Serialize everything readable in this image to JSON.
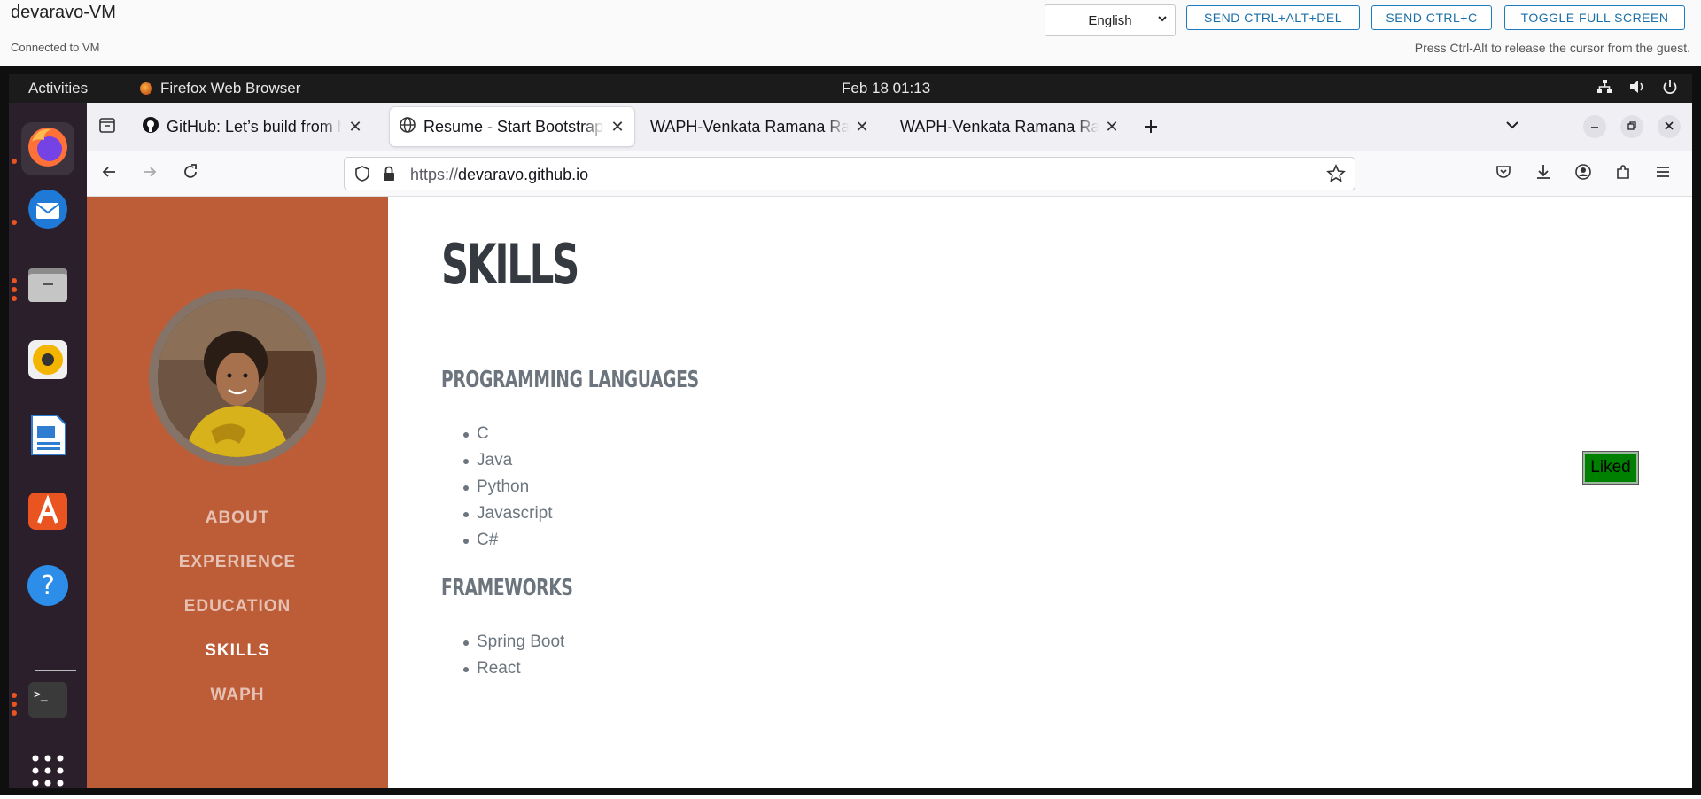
{
  "vm": {
    "title": "devaravo-VM",
    "status": "Connected to VM",
    "language": "English",
    "buttons": [
      "SEND CTRL+ALT+DEL",
      "SEND CTRL+C",
      "TOGGLE FULL SCREEN"
    ],
    "hint": "Press Ctrl-Alt to release the cursor from the guest."
  },
  "gnome": {
    "activities": "Activities",
    "app_name": "Firefox Web Browser",
    "clock": "Feb 18  01:13"
  },
  "dock": [
    "firefox",
    "thunderbird",
    "files",
    "rhythmbox",
    "libreoffice-writer",
    "app-center",
    "help",
    "terminal",
    "show-apps"
  ],
  "browser": {
    "tabs": [
      {
        "title": "GitHub: Let’s build from here",
        "icon": "github-icon",
        "active": false
      },
      {
        "title": "Resume - Start Bootstrap Theme",
        "icon": "globe-icon",
        "active": true
      },
      {
        "title": "WAPH-Venkata Ramana Rao",
        "icon": "",
        "active": false
      },
      {
        "title": "WAPH-Venkata Ramana Rao",
        "icon": "",
        "active": false
      }
    ],
    "url_scheme": "https://",
    "url_host": "devaravo.github.io"
  },
  "page": {
    "nav": [
      "ABOUT",
      "EXPERIENCE",
      "EDUCATION",
      "SKILLS",
      "WAPH"
    ],
    "active_nav": "SKILLS",
    "heading": "SKILLS",
    "sections": [
      {
        "title": "PROGRAMMING LANGUAGES",
        "items": [
          "C",
          "Java",
          "Python",
          "Javascript",
          "C#"
        ]
      },
      {
        "title": "FRAMEWORKS",
        "items": [
          "Spring Boot",
          "React"
        ]
      }
    ],
    "liked_label": "Liked"
  },
  "colors": {
    "sidebar": "#bd5d38",
    "liked_bg": "#008000",
    "heading": "#343a40",
    "muted": "#6c757d"
  }
}
